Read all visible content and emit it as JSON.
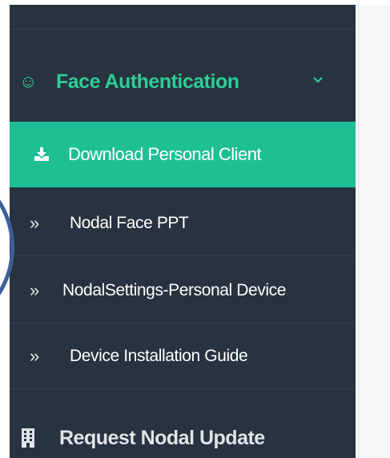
{
  "colors": {
    "sidebar_bg": "#27333f",
    "accent": "#2ecc96",
    "active_bg": "#1fbf96"
  },
  "section": {
    "title": "Face Authentication",
    "icon": "smile-icon",
    "expand_icon": "chevron-down-icon"
  },
  "menu": {
    "items": [
      {
        "label": "Download Personal Client",
        "icon": "download-icon",
        "active": true
      },
      {
        "label": "Nodal Face PPT",
        "icon": "double-chevron-icon",
        "active": false
      },
      {
        "label": "NodalSettings-Personal Device",
        "icon": "double-chevron-icon",
        "active": false
      },
      {
        "label": "Device Installation Guide",
        "icon": "double-chevron-icon",
        "active": false
      }
    ]
  },
  "footer": {
    "label": "Request Nodal Update",
    "icon": "building-icon"
  }
}
